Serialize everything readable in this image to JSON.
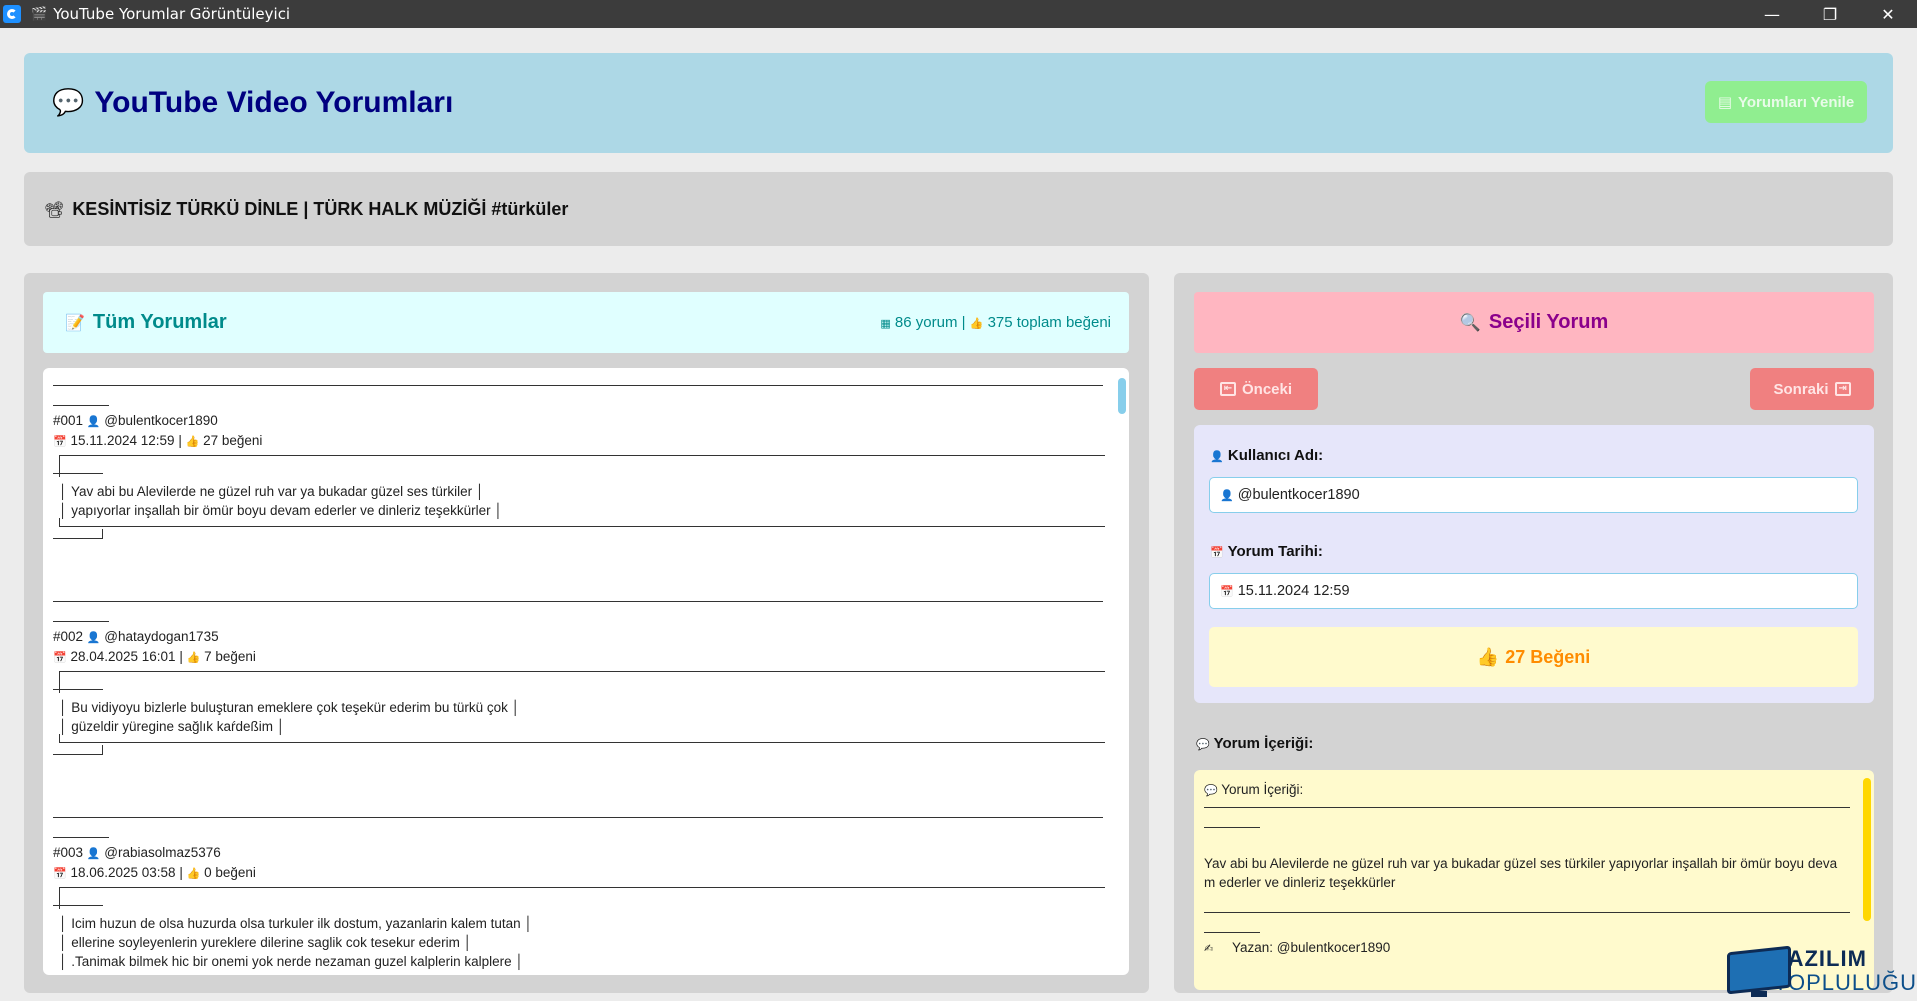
{
  "window": {
    "title": "YouTube Yorumlar Görüntüleyici",
    "controls": {
      "minimize": "—",
      "maximize": "❐",
      "close": "✕"
    }
  },
  "header": {
    "icon": "speech-bubble-icon",
    "icon_glyph": "💬",
    "title": "YouTube Video Yorumları",
    "refresh_label": "Yorumları Yenile",
    "refresh_icon_glyph": "▤"
  },
  "video": {
    "icon_glyph": "📽",
    "title": "KESİNTİSİZ TÜRKÜ DİNLE | TÜRK HALK MÜZİĞİ #türküler"
  },
  "comments_list": {
    "icon_glyph": "📝",
    "title": "Tüm Yorumlar",
    "stats_icon_glyph": "▦",
    "stats_count": "86 yorum |",
    "stats_likes_icon_glyph": "👍",
    "stats_likes": "375 toplam beğeni",
    "entries": [
      {
        "number": "#001",
        "user": "@bulentkocer1890",
        "date": "15.11.2024 12:59 |",
        "likes": "27 beğeni",
        "lines": [
          "│  Yav abi bu Alevilerde ne güzel ruh var ya bukadar güzel ses türkiler         │",
          "│  yapıyorlar inşallah bir ömür boyu devam ederler ve dinleriz teşekkürler       │"
        ]
      },
      {
        "number": "#002",
        "user": "@hataydogan1735",
        "date": "28.04.2025 16:01 |",
        "likes": "7 beğeni",
        "lines": [
          "│  Bu vidiyoyu bizlerle buluşturan emeklere çok teşekür ederim bu türkü çok      │",
          "│  güzeldir yüregine sağlık kaŕdeßim                                                                          │"
        ]
      },
      {
        "number": "#003",
        "user": "@rabiasolmaz5376",
        "date": "18.06.2025 03:58 |",
        "likes": "0 beğeni",
        "lines": [
          "│  Icim huzun de olsa huzurda olsa turkuler ilk dostum, yazanlarin kalem tutan   │",
          "│  ellerine soyleyenlerin yureklere dilerine saglik cok tesekur ederim           │",
          "│  .Tanimak bilmek hic bir onemi yok nerde nezaman guzel kalplerin kalplere      │"
        ]
      }
    ]
  },
  "selected": {
    "icon_glyph": "🔍",
    "title": "Seçili Yorum",
    "prev_label": "Önceki",
    "prev_icon_glyph": "⇤",
    "next_label": "Sonraki",
    "next_icon_glyph": "⇥",
    "username_label": "Kullanıcı Adı:",
    "username_value": "@bulentkocer1890",
    "date_label": "Yorum Tarihi:",
    "date_value": "15.11.2024 12:59",
    "likes_label": "27 Beğeni",
    "content_label": "Yorum İçeriği:",
    "content_header": "Yorum İçeriği:",
    "content_text_1": "Yav abi bu Alevilerde ne güzel ruh var ya bukadar güzel ses türkiler yapıyorlar inşallah bir ömür boyu deva",
    "content_text_2": "m ederler ve dinleriz teşekkürler",
    "author_line": "Yazan: @bulentkocer1890"
  },
  "watermark": {
    "line1": "YAZILIM",
    "line2": "TOPLULUĞU"
  },
  "colors": {
    "header_bg": "#add8e6",
    "header_text": "#000080",
    "refresh_bg": "#90ee90",
    "list_header_bg": "#e0ffff",
    "list_header_text": "#008b8b",
    "selected_header_bg": "#ffb6c1",
    "selected_header_text": "#8b008b",
    "nav_btn_bg": "#f08080",
    "info_bg": "#e6e6fa",
    "likes_bg": "#fffacd",
    "likes_text": "#ff8c00",
    "content_scroll": "#ffd700"
  }
}
